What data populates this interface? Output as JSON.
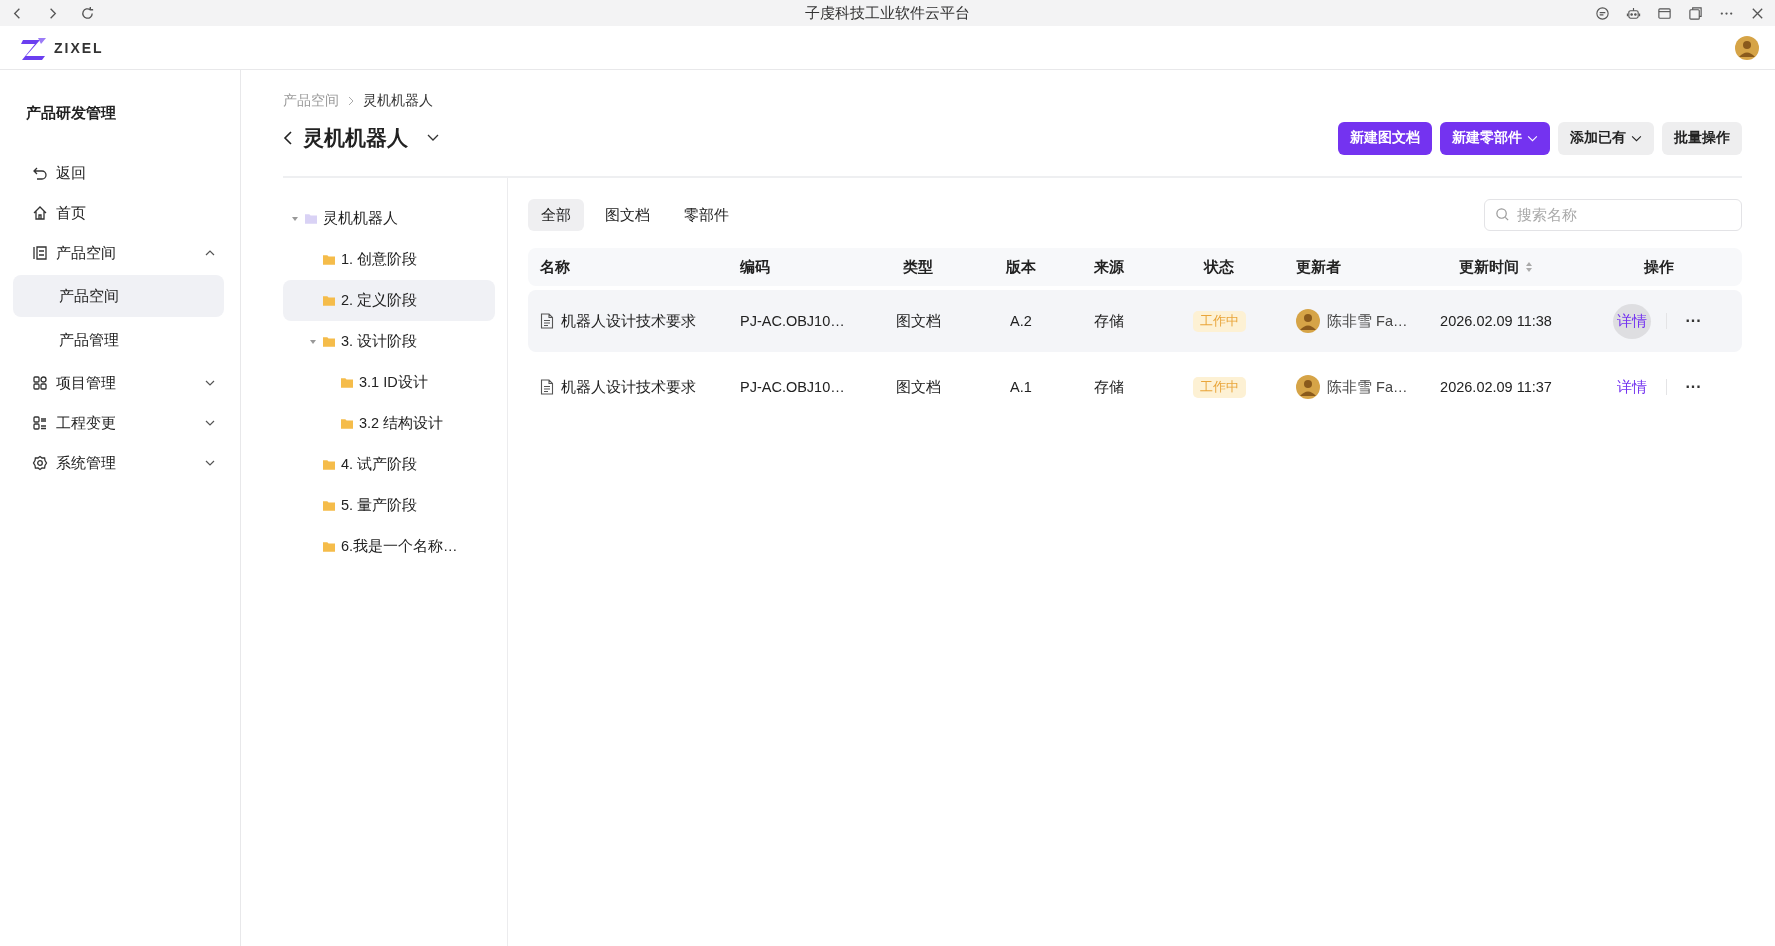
{
  "window": {
    "title": "子虔科技工业软件云平台"
  },
  "app_header": {
    "logo_text": "ZIXEL"
  },
  "sidebar": {
    "title": "产品研发管理",
    "items": [
      {
        "kind": "link",
        "label": "返回"
      },
      {
        "kind": "link",
        "label": "首页"
      },
      {
        "kind": "group",
        "label": "产品空间",
        "expanded": true,
        "children": [
          {
            "label": "产品空间",
            "selected": true
          },
          {
            "label": "产品管理",
            "selected": false
          }
        ]
      },
      {
        "kind": "group",
        "label": "项目管理",
        "expanded": false
      },
      {
        "kind": "group",
        "label": "工程变更",
        "expanded": false
      },
      {
        "kind": "group",
        "label": "系统管理",
        "expanded": false
      }
    ]
  },
  "breadcrumb": [
    {
      "label": "产品空间",
      "current": false
    },
    {
      "label": "灵机机器人",
      "current": true
    }
  ],
  "page_title": "灵机机器人",
  "actions": [
    {
      "label": "新建图文档",
      "kind": "primary",
      "dropdown": false
    },
    {
      "label": "新建零部件",
      "kind": "primary",
      "dropdown": true
    },
    {
      "label": "添加已有",
      "kind": "secondary",
      "dropdown": true
    },
    {
      "label": "批量操作",
      "kind": "secondary",
      "dropdown": false
    }
  ],
  "tree": {
    "label": "灵机机器人",
    "expanded": true,
    "selected": false,
    "children": [
      {
        "label": "1. 创意阶段",
        "selected": false
      },
      {
        "label": "2. 定义阶段",
        "selected": true
      },
      {
        "label": "3. 设计阶段",
        "selected": false,
        "expanded": true,
        "children": [
          {
            "label": "3.1 ID设计",
            "selected": false
          },
          {
            "label": "3.2 结构设计",
            "selected": false
          }
        ]
      },
      {
        "label": "4. 试产阶段",
        "selected": false
      },
      {
        "label": "5. 量产阶段",
        "selected": false
      },
      {
        "label": "6.我是一个名称…",
        "selected": false
      }
    ]
  },
  "tabs": [
    {
      "label": "全部",
      "selected": true
    },
    {
      "label": "图文档",
      "selected": false
    },
    {
      "label": "零部件",
      "selected": false
    }
  ],
  "search": {
    "placeholder": "搜索名称"
  },
  "table": {
    "columns": [
      {
        "label": "名称"
      },
      {
        "label": "编码"
      },
      {
        "label": "类型"
      },
      {
        "label": "版本"
      },
      {
        "label": "来源"
      },
      {
        "label": "状态"
      },
      {
        "label": "更新者"
      },
      {
        "label": "更新时间",
        "sortable": true
      },
      {
        "label": "操作"
      }
    ],
    "rows": [
      {
        "hovered": true,
        "name": "机器人设计技术要求",
        "code": "PJ-AC.OBJ10…",
        "type": "图文档",
        "version": "A.2",
        "source": "存储",
        "status": "工作中",
        "updater": "陈非雪 Fa…",
        "updated": "2026.02.09 11:38",
        "action": "详情",
        "more": "···"
      },
      {
        "hovered": false,
        "name": "机器人设计技术要求",
        "code": "PJ-AC.OBJ10…",
        "type": "图文档",
        "version": "A.1",
        "source": "存储",
        "status": "工作中",
        "updater": "陈非雪 Fa…",
        "updated": "2026.02.09 11:37",
        "action": "详情",
        "more": "···"
      }
    ]
  }
}
